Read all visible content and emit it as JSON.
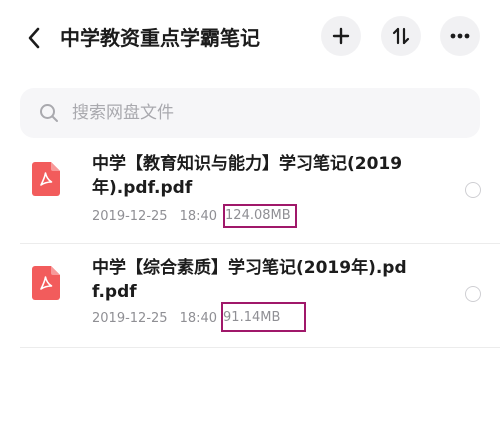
{
  "header": {
    "title": "中学教资重点学霸笔记",
    "back_icon": "chevron-left-icon",
    "add_icon": "plus-icon",
    "sort_icon": "sort-arrows-icon",
    "more_icon": "ellipsis-icon"
  },
  "search": {
    "placeholder": "搜索网盘文件",
    "value": ""
  },
  "files": [
    {
      "name": "中学【教育知识与能力】学习笔记(2019年).pdf.pdf",
      "date": "2019-12-25",
      "time": "18:40",
      "size": "124.08MB",
      "icon": "pdf-file-icon",
      "selected": false
    },
    {
      "name": "中学【综合素质】学习笔记(2019年).pdf.pdf",
      "date": "2019-12-25",
      "time": "18:40",
      "size": "91.14MB",
      "icon": "pdf-file-icon",
      "selected": false
    }
  ],
  "colors": {
    "pdf_red": "#f25c5c",
    "highlight_box": "#a0186a",
    "search_bg": "#f6f6f8",
    "button_bg": "#f1f1f3"
  }
}
